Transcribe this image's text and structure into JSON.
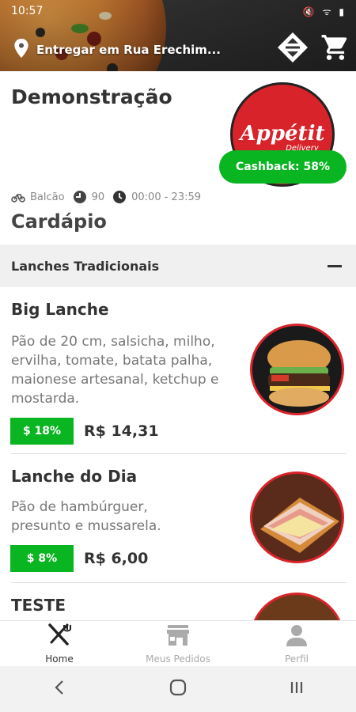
{
  "status_bar": {
    "time": "10:57",
    "icons": "🔇 ᯤ ▮"
  },
  "header": {
    "location_text": "Entregar em Rua Erechim...",
    "icons": {
      "location": "map-pin-icon",
      "sort": "sort-icon",
      "cart": "shopping-cart-icon"
    }
  },
  "store": {
    "name": "Demonstração",
    "logo_text": "Appétit",
    "logo_subtext": "Delivery",
    "cashback": "Cashback: 58%",
    "pickup": "Balcão",
    "delivery_time": "90",
    "hours": "00:00 - 23:59"
  },
  "menu": {
    "title": "Cardápio",
    "category": "Lanches Tradicionais",
    "items": [
      {
        "title": "Big Lanche",
        "description": "Pão de 20 cm, salsicha, milho, ervilha, tomate, batata palha, maionese artesanal, ketchup e mostarda.",
        "discount": "$ 18%",
        "price": "R$ 14,31"
      },
      {
        "title": "Lanche do Dia",
        "description": "Pão de hambúrguer, presunto e mussarela.",
        "discount": "$ 8%",
        "price": "R$ 6,00"
      },
      {
        "title": "TESTE"
      }
    ]
  },
  "bottom_nav": [
    {
      "label": "Home",
      "icon": "fork-knife-icon"
    },
    {
      "label": "Meus Pedidos",
      "icon": "store-icon"
    },
    {
      "label": "Perfil",
      "icon": "person-icon"
    }
  ],
  "colors": {
    "accent_green": "#0ab522",
    "brand_red": "#d8232a"
  }
}
